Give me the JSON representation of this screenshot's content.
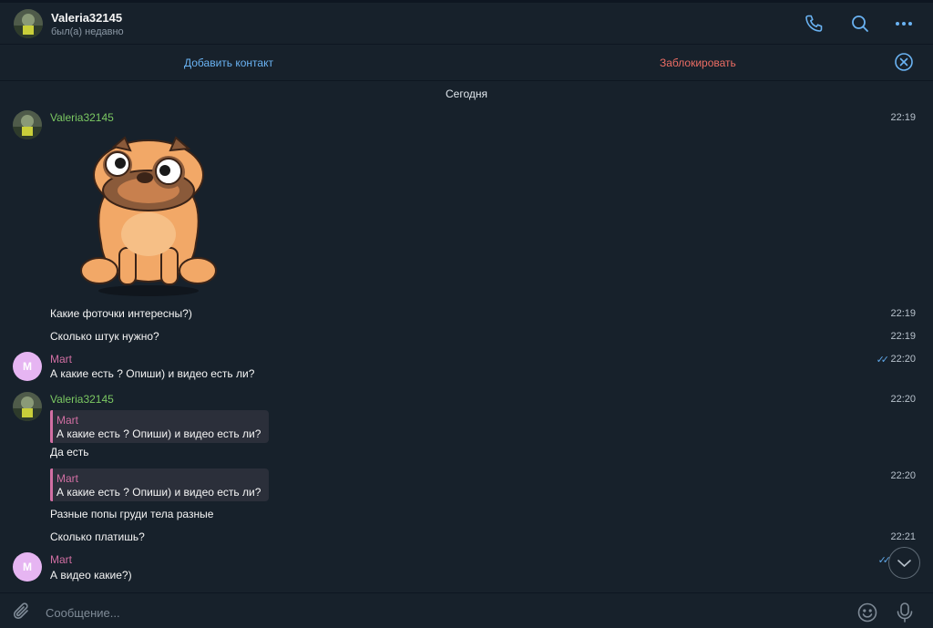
{
  "header": {
    "contact_name": "Valeria32145",
    "status": "был(а) недавно",
    "call_icon": "phone-icon",
    "search_icon": "search-icon",
    "more_icon": "more-icon"
  },
  "action_bar": {
    "add_contact": "Добавить контакт",
    "block": "Заблокировать",
    "close_icon": "close-circle-icon"
  },
  "chat": {
    "date_separator": "Сегодня",
    "avatar_letter": "M",
    "messages": [
      {
        "sender": "Valeria32145",
        "type": "sticker",
        "time": "22:19"
      },
      {
        "text": "Какие фоточки интересны?)",
        "time": "22:19"
      },
      {
        "text": "Сколько штук нужно?",
        "time": "22:19"
      },
      {
        "sender": "Mart",
        "text": "А какие есть ? Опиши) и видео есть ли?",
        "time": "22:20",
        "read": true
      },
      {
        "sender": "Valeria32145",
        "reply_to": {
          "name": "Mart",
          "text": "А какие есть ? Опиши) и видео есть ли?"
        },
        "text": "Да есть",
        "time": "22:20"
      },
      {
        "reply_to": {
          "name": "Mart",
          "text": "А какие есть ? Опиши) и видео есть ли?"
        },
        "text": "Разные попы груди тела разные",
        "time": "22:20"
      },
      {
        "text": "Сколько платишь?",
        "time": "22:21"
      },
      {
        "sender": "Mart",
        "text": "А видео какие?)",
        "read": true
      }
    ]
  },
  "composer": {
    "placeholder": "Сообщение...",
    "attach_icon": "paperclip-icon",
    "emoji_icon": "emoji-icon",
    "mic_icon": "microphone-icon"
  },
  "colors": {
    "background": "#17212b",
    "accent": "#6ab3f3",
    "danger": "#ec6d64",
    "sender_valeria": "#7bc862",
    "sender_mart": "#d16fa3"
  }
}
